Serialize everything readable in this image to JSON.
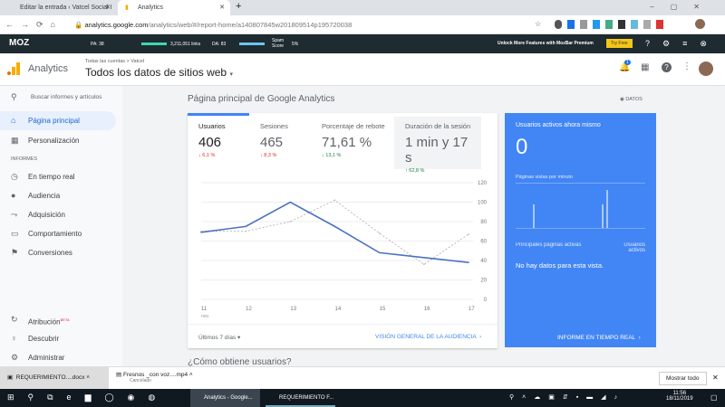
{
  "browser": {
    "tabs": [
      {
        "label": "Editar la entrada ‹ Vatcel Social I"
      },
      {
        "label": "Analytics"
      }
    ],
    "url_host": "analytics.google.com",
    "url_path": "/analytics/web/#/report-home/a140807845w201809514p195720038"
  },
  "mozbar": {
    "logo": "MOZ",
    "pa": "PA: 38",
    "links": "3,211,051 links",
    "da": "DA: 83",
    "spam_label": "Spam Score",
    "spam": "5%",
    "promo": "Unlock More Features with MozBar Premium",
    "try": "Try Free"
  },
  "header": {
    "app": "Analytics",
    "breadcrumb": "Todas las cuentas > Vatcel",
    "view": "Todos los datos de sitios web",
    "notif_count": "1"
  },
  "sidebar": {
    "search": "Buscar informes y artículos",
    "items": [
      {
        "label": "Página principal"
      },
      {
        "label": "Personalización"
      }
    ],
    "section": "INFORMES",
    "reports": [
      {
        "label": "En tiempo real"
      },
      {
        "label": "Audiencia"
      },
      {
        "label": "Adquisición"
      },
      {
        "label": "Comportamiento"
      },
      {
        "label": "Conversiones"
      }
    ],
    "bottom": [
      {
        "label": "Atribución",
        "badge": "BETA"
      },
      {
        "label": "Descubrir"
      },
      {
        "label": "Administrar"
      }
    ]
  },
  "main": {
    "title": "Página principal de Google Analytics",
    "datos": "DATOS",
    "next_title": "¿Cómo obtiene usuarios?",
    "metrics": [
      {
        "label": "Usuarios",
        "value": "406",
        "delta": "↓ 6,1 %",
        "color": "#d93025"
      },
      {
        "label": "Sesiones",
        "value": "465",
        "delta": "↓ 8,3 %",
        "color": "#d93025"
      },
      {
        "label": "Porcentaje de rebote",
        "value": "71,61 %",
        "delta": "↓ 13,1 %",
        "color": "#188038"
      },
      {
        "label": "Duración de la sesión",
        "value": "1 min y 17 s",
        "delta": "↑ 62,8 %",
        "color": "#188038"
      }
    ],
    "range": "Últimos 7 días",
    "audience_link": "VISIÓN GENERAL DE LA AUDIENCIA"
  },
  "chart_data": {
    "type": "line",
    "x": [
      "11",
      "12",
      "13",
      "14",
      "15",
      "16",
      "17"
    ],
    "x_sub": "nov.",
    "ylim": [
      0,
      120
    ],
    "yticks": [
      0,
      20,
      40,
      60,
      80,
      100,
      120
    ],
    "series": [
      {
        "values": [
          69,
          75,
          100,
          75,
          48,
          43,
          38
        ],
        "style": "solid",
        "color": "#4a72c4"
      },
      {
        "values": [
          70,
          70,
          80,
          102,
          68,
          36,
          67
        ],
        "style": "dotted",
        "color": "#bbbbbb"
      }
    ],
    "grid": true
  },
  "realtime": {
    "title": "Usuarios activos ahora mismo",
    "value": "0",
    "ppm": "Páginas vistas por minuto",
    "pages": "Principales páginas activas",
    "users": "Usuarios activos",
    "empty": "No hay datos para esta vista.",
    "link": "INFORME EN TIEMPO REAL",
    "bars": [
      0,
      0,
      0,
      0,
      0,
      0,
      0,
      0,
      2,
      0,
      0,
      0,
      0,
      0,
      0,
      0,
      0,
      0,
      0,
      0,
      0,
      0,
      0,
      0,
      0,
      0,
      0,
      0,
      0,
      0,
      0,
      0,
      0,
      0,
      0,
      0,
      0,
      0,
      0,
      0,
      2,
      0,
      3.2,
      0,
      0,
      0,
      0,
      0,
      0,
      0,
      0,
      0,
      0,
      0,
      0,
      0,
      0,
      0,
      0,
      0
    ]
  },
  "downloads": [
    {
      "name": "REQUERIMIENTO....docx"
    },
    {
      "name": "Fresnos _con voz....mp4",
      "status": "Cancelado"
    }
  ],
  "show_all": "Mostrar todo",
  "taskbar": {
    "apps": [
      {
        "label": "Analytics - Google..."
      },
      {
        "label": "REQUERIMIENTO F..."
      }
    ],
    "time": "11:56",
    "date": "18/11/2019"
  }
}
